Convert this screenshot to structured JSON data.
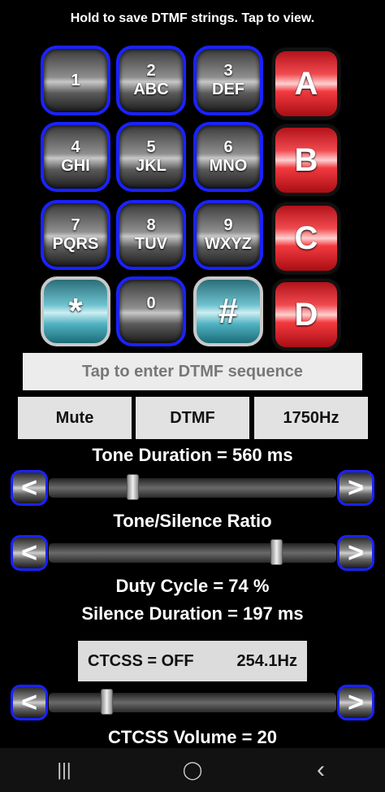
{
  "hint": "Hold to save DTMF strings. Tap to view.",
  "keypad": {
    "k1": {
      "digit": "1",
      "letters": ""
    },
    "k2": {
      "digit": "2",
      "letters": "ABC"
    },
    "k3": {
      "digit": "3",
      "letters": "DEF"
    },
    "k4": {
      "digit": "4",
      "letters": "GHI"
    },
    "k5": {
      "digit": "5",
      "letters": "JKL"
    },
    "k6": {
      "digit": "6",
      "letters": "MNO"
    },
    "k7": {
      "digit": "7",
      "letters": "PQRS"
    },
    "k8": {
      "digit": "8",
      "letters": "TUV"
    },
    "k9": {
      "digit": "9",
      "letters": "WXYZ"
    },
    "kstar": {
      "digit": "*"
    },
    "k0": {
      "digit": "0"
    },
    "khash": {
      "digit": "#"
    },
    "kA": "A",
    "kB": "B",
    "kC": "C",
    "kD": "D"
  },
  "sequence": {
    "placeholder": "Tap to enter DTMF sequence"
  },
  "buttons": {
    "mute": "Mute",
    "dtmf": "DTMF",
    "tone": "1750Hz"
  },
  "tone_duration": {
    "label": "Tone Duration = 560 ms",
    "level": 0.29
  },
  "ratio": {
    "label": "Tone/Silence Ratio",
    "level": 0.79
  },
  "duty_cycle": "Duty Cycle = 74 %",
  "silence_duration": "Silence Duration = 197 ms",
  "ctcss": {
    "state": "CTCSS = OFF",
    "frequency": "254.1Hz"
  },
  "ctcss_volume": {
    "label": "CTCSS Volume = 20",
    "level": 0.2
  },
  "arrows": {
    "left": "<",
    "right": ">"
  },
  "nav": {
    "recents": "|||",
    "home": "◯",
    "back": "‹"
  }
}
